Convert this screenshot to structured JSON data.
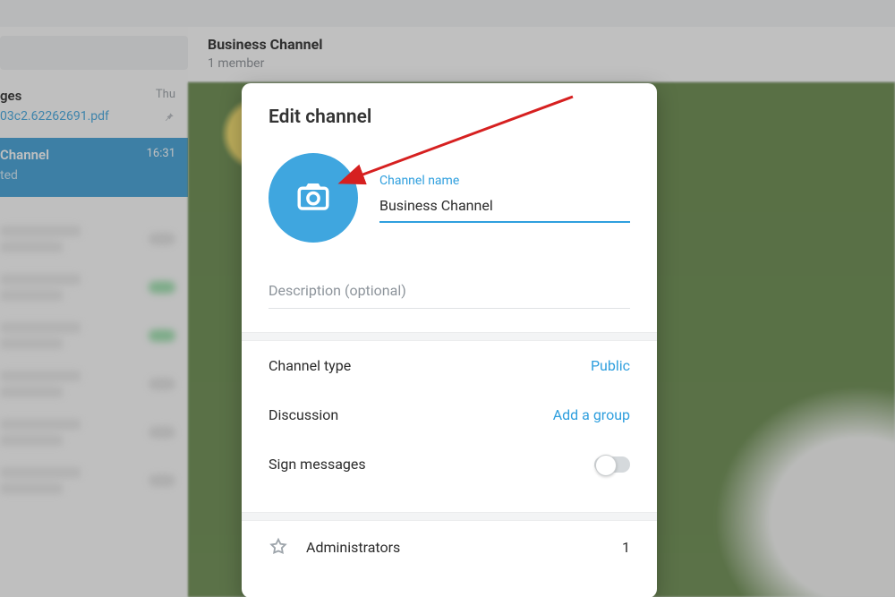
{
  "header": {
    "title": "Business Channel",
    "subtitle": "1 member"
  },
  "sidebar": {
    "items": [
      {
        "title_suffix": "ges",
        "sub": "03c2.62262691.pdf",
        "time": "Thu",
        "pinned": true
      },
      {
        "title_suffix": "Channel",
        "sub": "ted",
        "time": "16:31",
        "active": true
      }
    ]
  },
  "modal": {
    "title": "Edit channel",
    "name_label": "Channel name",
    "name_value": "Business Channel",
    "desc_placeholder": "Description (optional)",
    "rows": {
      "channel_type": {
        "label": "Channel type",
        "value": "Public"
      },
      "discussion": {
        "label": "Discussion",
        "value": "Add a group"
      },
      "sign": {
        "label": "Sign messages",
        "toggle": false
      }
    },
    "admin": {
      "label": "Administrators",
      "count": "1"
    }
  }
}
